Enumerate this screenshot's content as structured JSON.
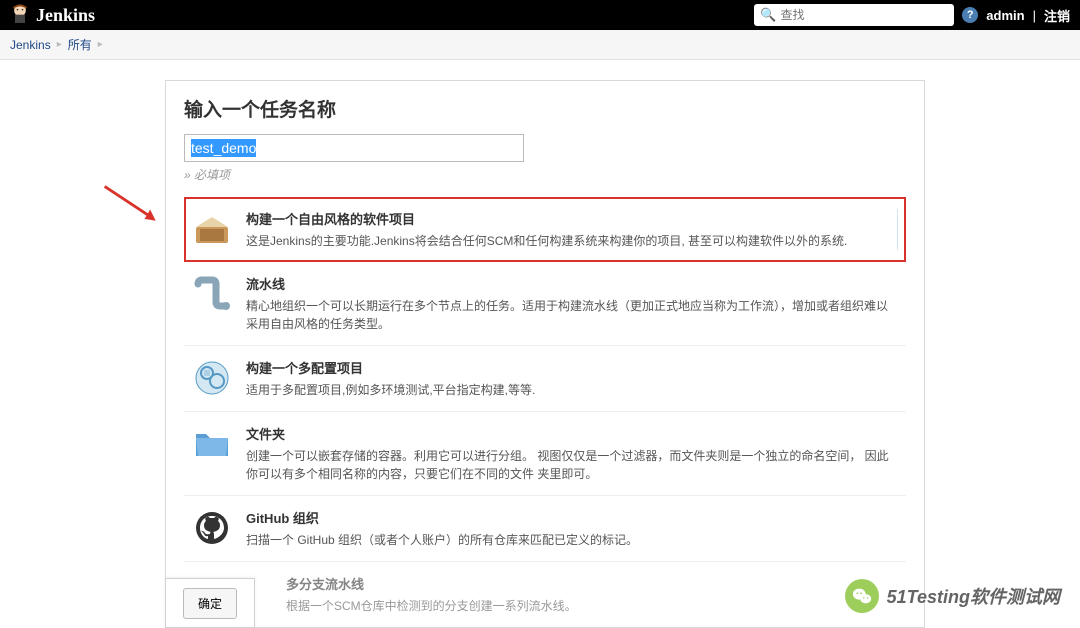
{
  "header": {
    "brand": "Jenkins",
    "search_placeholder": "查找",
    "user": "admin",
    "logout": "注销"
  },
  "breadcrumbs": {
    "items": [
      "Jenkins",
      "所有"
    ]
  },
  "form": {
    "title": "输入一个任务名称",
    "name_value": "test_demo",
    "required_hint": "» 必填项"
  },
  "items": [
    {
      "title": "构建一个自由风格的软件项目",
      "desc": "这是Jenkins的主要功能.Jenkins将会结合任何SCM和任何构建系统来构建你的项目, 甚至可以构建软件以外的系统.",
      "selected": true
    },
    {
      "title": "流水线",
      "desc": "精心地组织一个可以长期运行在多个节点上的任务。适用于构建流水线（更加正式地应当称为工作流），增加或者组织难以采用自由风格的任务类型。"
    },
    {
      "title": "构建一个多配置项目",
      "desc": "适用于多配置项目,例如多环境测试,平台指定构建,等等."
    },
    {
      "title": "文件夹",
      "desc": "创建一个可以嵌套存储的容器。利用它可以进行分组。 视图仅仅是一个过滤器，而文件夹则是一个独立的命名空间， 因此你可以有多个相同名称的内容，只要它们在不同的文件 夹里即可。"
    },
    {
      "title": "GitHub 组织",
      "desc": "扫描一个 GitHub 组织（或者个人账户）的所有仓库来匹配已定义的标记。"
    },
    {
      "title": "多分支流水线",
      "desc": "根据一个SCM仓库中检测到的分支创建一系列流水线。",
      "dimmed": true
    }
  ],
  "ok_button": "确定",
  "watermark": "51Testing软件测试网"
}
